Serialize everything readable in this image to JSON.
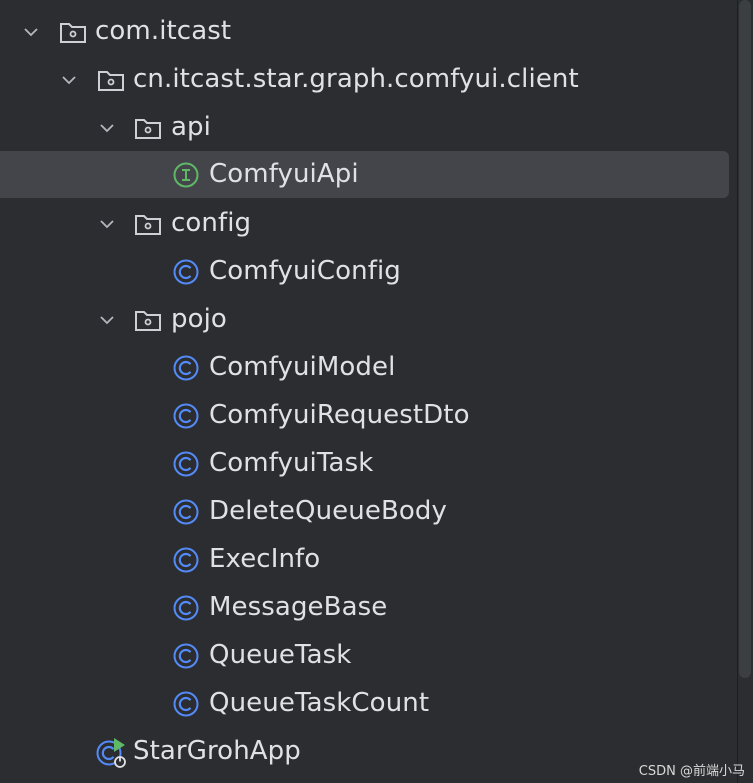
{
  "tree": {
    "root": {
      "label": "com.itcast",
      "icon": "package-folder-icon",
      "expanded": true
    },
    "package": {
      "label": "cn.itcast.star.graph.comfyui.client",
      "icon": "package-folder-icon",
      "expanded": true
    },
    "folders": {
      "api": {
        "label": "api",
        "icon": "package-folder-icon",
        "expanded": true
      },
      "config": {
        "label": "config",
        "icon": "package-folder-icon",
        "expanded": true
      },
      "pojo": {
        "label": "pojo",
        "icon": "package-folder-icon",
        "expanded": true
      }
    },
    "items": {
      "comfyui_api": {
        "label": "ComfyuiApi",
        "icon": "interface-icon"
      },
      "comfyui_config": {
        "label": "ComfyuiConfig",
        "icon": "class-icon"
      },
      "comfyui_model": {
        "label": "ComfyuiModel",
        "icon": "class-icon"
      },
      "comfyui_request_dto": {
        "label": "ComfyuiRequestDto",
        "icon": "class-icon"
      },
      "comfyui_task": {
        "label": "ComfyuiTask",
        "icon": "class-icon"
      },
      "delete_queue_body": {
        "label": "DeleteQueueBody",
        "icon": "class-icon"
      },
      "exec_info": {
        "label": "ExecInfo",
        "icon": "class-icon"
      },
      "message_base": {
        "label": "MessageBase",
        "icon": "class-icon"
      },
      "queue_task": {
        "label": "QueueTask",
        "icon": "class-icon"
      },
      "queue_task_count": {
        "label": "QueueTaskCount",
        "icon": "class-icon"
      },
      "star_groh_app": {
        "label": "StarGrohApp",
        "icon": "spring-boot-app-icon"
      }
    },
    "selected": "ComfyuiApi"
  },
  "watermark": "CSDN @前端小马",
  "colors": {
    "background": "#2b2d30",
    "selection": "#43454a",
    "text": "#dfe1e5",
    "class_icon": "#548af7",
    "interface_icon": "#5fb865",
    "chevron": "#b4b8bf"
  }
}
